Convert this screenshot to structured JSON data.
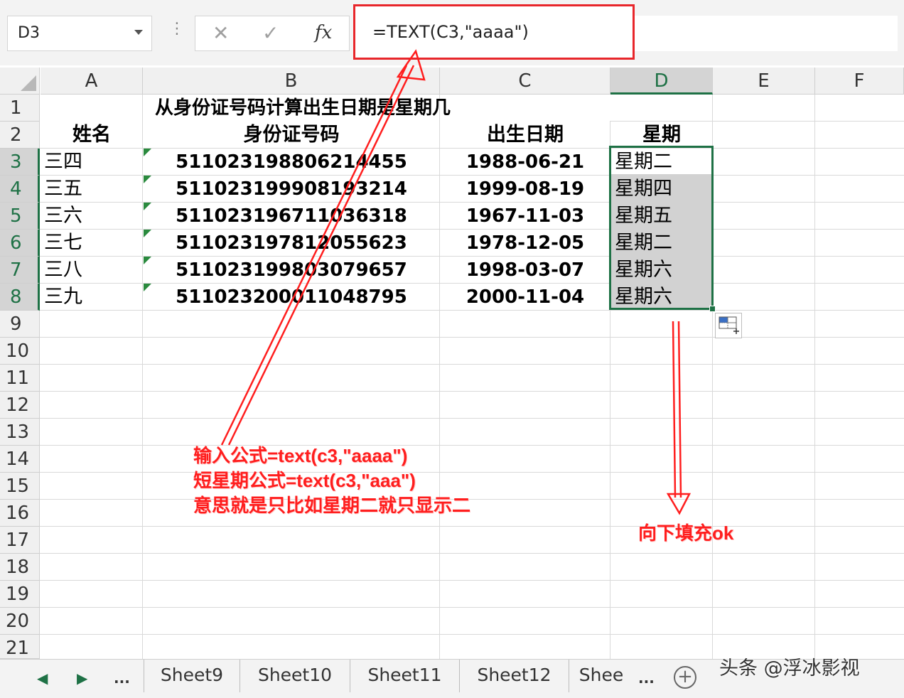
{
  "formula_bar": {
    "name_box": "D3",
    "divider": "⋮",
    "cancel_glyph": "✕",
    "enter_glyph": "✓",
    "fx_glyph": "fx",
    "formula": "=TEXT(C3,\"aaaa\")"
  },
  "columns": [
    "A",
    "B",
    "C",
    "D",
    "E",
    "F"
  ],
  "rows": [
    "1",
    "2",
    "3",
    "4",
    "5",
    "6",
    "7",
    "8",
    "9",
    "10",
    "11",
    "12",
    "13",
    "14",
    "15",
    "16",
    "17",
    "18",
    "19",
    "20",
    "21"
  ],
  "sheet": {
    "title": "从身份证号码计算出生日期是星期几",
    "headers": {
      "name": "姓名",
      "id": "身份证号码",
      "birth": "出生日期",
      "weekday": "星期"
    },
    "records": [
      {
        "name": "三四",
        "id": "511023198806214455",
        "birth": "1988-06-21",
        "weekday": "星期二"
      },
      {
        "name": "三五",
        "id": "511023199908193214",
        "birth": "1999-08-19",
        "weekday": "星期四"
      },
      {
        "name": "三六",
        "id": "511023196711036318",
        "birth": "1967-11-03",
        "weekday": "星期五"
      },
      {
        "name": "三七",
        "id": "511023197812055623",
        "birth": "1978-12-05",
        "weekday": "星期二"
      },
      {
        "name": "三八",
        "id": "511023199803079657",
        "birth": "1998-03-07",
        "weekday": "星期六"
      },
      {
        "name": "三九",
        "id": "511023200011048795",
        "birth": "2000-11-04",
        "weekday": "星期六"
      }
    ]
  },
  "annotations": {
    "formula_note": [
      "输入公式=text(c3,\"aaaa\")",
      "短星期公式=text(c3,\"aaa\")",
      "意思就是只比如星期二就只显示二"
    ],
    "fill_note": "向下填充ok"
  },
  "tabs": {
    "nav_prev": "◀",
    "nav_next": "▶",
    "nav_more": "...",
    "items": [
      "Sheet9",
      "Sheet10",
      "Sheet11",
      "Sheet12",
      "Shee"
    ],
    "trailing_more": "...",
    "add_glyph": "+"
  },
  "watermark": "头条 @浮冰影视",
  "colors": {
    "selection_green": "#1e7145",
    "annotation_red": "#ff1e1e",
    "header_gray": "#f0f0f0"
  }
}
